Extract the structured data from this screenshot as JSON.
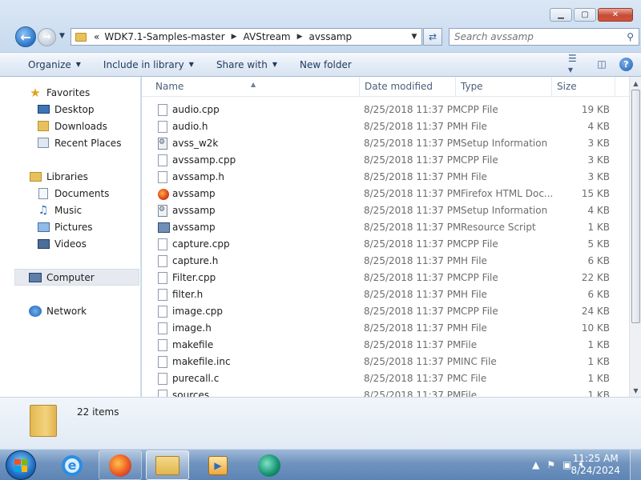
{
  "address": {
    "overflow": "«",
    "segments": [
      "WDK7.1-Samples-master",
      "AVStream",
      "avssamp"
    ]
  },
  "search": {
    "placeholder": "Search avssamp"
  },
  "toolbar": {
    "organize": "Organize",
    "include": "Include in library",
    "share": "Share with",
    "new_folder": "New folder"
  },
  "nav": {
    "favorites": "Favorites",
    "desktop": "Desktop",
    "downloads": "Downloads",
    "recent": "Recent Places",
    "libraries": "Libraries",
    "documents": "Documents",
    "music": "Music",
    "pictures": "Pictures",
    "videos": "Videos",
    "computer": "Computer",
    "network": "Network"
  },
  "columns": {
    "name": "Name",
    "date": "Date modified",
    "type": "Type",
    "size": "Size"
  },
  "files": [
    {
      "name": "audio.cpp",
      "date": "8/25/2018 11:37 PM",
      "type": "CPP File",
      "size": "19 KB",
      "icon": "doc"
    },
    {
      "name": "audio.h",
      "date": "8/25/2018 11:37 PM",
      "type": "H File",
      "size": "4 KB",
      "icon": "doc"
    },
    {
      "name": "avss_w2k",
      "date": "8/25/2018 11:37 PM",
      "type": "Setup Information",
      "size": "3 KB",
      "icon": "setup"
    },
    {
      "name": "avssamp.cpp",
      "date": "8/25/2018 11:37 PM",
      "type": "CPP File",
      "size": "3 KB",
      "icon": "doc"
    },
    {
      "name": "avssamp.h",
      "date": "8/25/2018 11:37 PM",
      "type": "H File",
      "size": "3 KB",
      "icon": "doc"
    },
    {
      "name": "avssamp",
      "date": "8/25/2018 11:37 PM",
      "type": "Firefox HTML Doc...",
      "size": "15 KB",
      "icon": "firefox"
    },
    {
      "name": "avssamp",
      "date": "8/25/2018 11:37 PM",
      "type": "Setup Information",
      "size": "4 KB",
      "icon": "setup"
    },
    {
      "name": "avssamp",
      "date": "8/25/2018 11:37 PM",
      "type": "Resource Script",
      "size": "1 KB",
      "icon": "rc"
    },
    {
      "name": "capture.cpp",
      "date": "8/25/2018 11:37 PM",
      "type": "CPP File",
      "size": "5 KB",
      "icon": "doc"
    },
    {
      "name": "capture.h",
      "date": "8/25/2018 11:37 PM",
      "type": "H File",
      "size": "6 KB",
      "icon": "doc"
    },
    {
      "name": "Filter.cpp",
      "date": "8/25/2018 11:37 PM",
      "type": "CPP File",
      "size": "22 KB",
      "icon": "doc"
    },
    {
      "name": "filter.h",
      "date": "8/25/2018 11:37 PM",
      "type": "H File",
      "size": "6 KB",
      "icon": "doc"
    },
    {
      "name": "image.cpp",
      "date": "8/25/2018 11:37 PM",
      "type": "CPP File",
      "size": "24 KB",
      "icon": "doc"
    },
    {
      "name": "image.h",
      "date": "8/25/2018 11:37 PM",
      "type": "H File",
      "size": "10 KB",
      "icon": "doc"
    },
    {
      "name": "makefile",
      "date": "8/25/2018 11:37 PM",
      "type": "File",
      "size": "1 KB",
      "icon": "doc"
    },
    {
      "name": "makefile.inc",
      "date": "8/25/2018 11:37 PM",
      "type": "INC File",
      "size": "1 KB",
      "icon": "doc"
    },
    {
      "name": "purecall.c",
      "date": "8/25/2018 11:37 PM",
      "type": "C File",
      "size": "1 KB",
      "icon": "doc"
    },
    {
      "name": "sources",
      "date": "8/25/2018 11:37 PM",
      "type": "File",
      "size": "1 KB",
      "icon": "doc"
    }
  ],
  "details": {
    "count": "22 items"
  },
  "taskbar": {
    "apps": [
      "internet-explorer",
      "firefox",
      "windows-explorer",
      "media-player",
      "app-circle"
    ],
    "time": "11:25 AM",
    "date": "8/24/2024"
  }
}
